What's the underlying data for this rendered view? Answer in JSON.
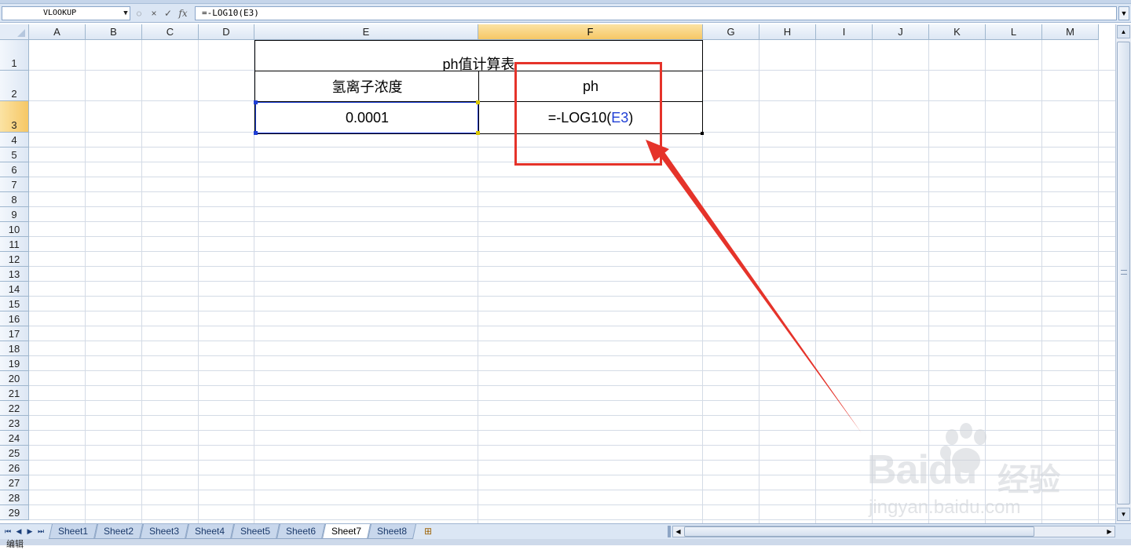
{
  "formula_bar": {
    "name_box": "VLOOKUP",
    "formula": "=-LOG10(E3)",
    "fx_label": "fx",
    "cancel_symbol": "×",
    "enter_symbol": "✓"
  },
  "columns": [
    "A",
    "B",
    "C",
    "D",
    "E",
    "F",
    "G",
    "H",
    "I",
    "J",
    "K",
    "L",
    "M"
  ],
  "selected_column": "F",
  "rows": [
    "1",
    "2",
    "3",
    "4",
    "5",
    "6",
    "7",
    "8",
    "9",
    "10",
    "11",
    "12",
    "13",
    "14",
    "15",
    "16",
    "17",
    "18",
    "19",
    "20",
    "21",
    "22",
    "23",
    "24",
    "25",
    "26",
    "27",
    "28",
    "29"
  ],
  "selected_row": "3",
  "table": {
    "title": "ph值计算表",
    "header_left": "氢离子浓度",
    "header_right": "ph",
    "value_left": "0.0001",
    "formula_prefix": "=-LOG10(",
    "formula_ref": "E3",
    "formula_suffix": ")"
  },
  "sheet_tabs": [
    "Sheet1",
    "Sheet2",
    "Sheet3",
    "Sheet4",
    "Sheet5",
    "Sheet6",
    "Sheet7",
    "Sheet8"
  ],
  "active_sheet": "Sheet7",
  "annotation_color": "#e5332a",
  "watermark": {
    "brand": "Bai",
    "brand2": "du",
    "cn": "经验",
    "url": "jingyan.baidu.com"
  },
  "status": {
    "mode": "编辑"
  }
}
